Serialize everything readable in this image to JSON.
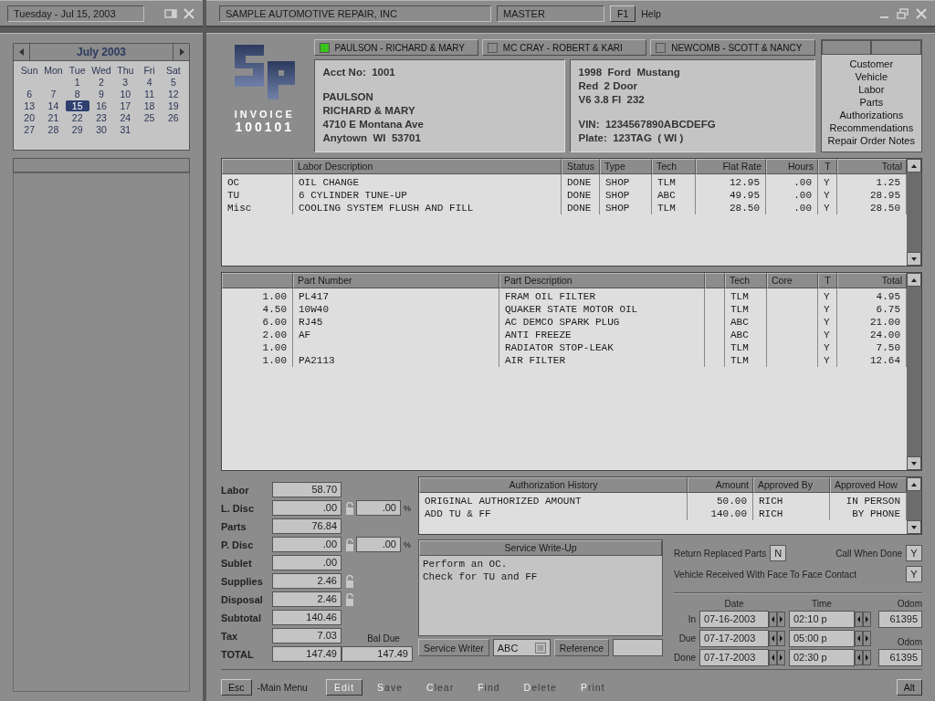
{
  "side": {
    "date_display": "Tuesday - Jul 15, 2003",
    "calendar": {
      "month_title": "July  2003",
      "weekdays": [
        "Sun",
        "Mon",
        "Tue",
        "Wed",
        "Thu",
        "Fri",
        "Sat"
      ],
      "weeks": [
        [
          {
            "day": "1",
            "selected": false
          },
          {
            "day": "2",
            "selected": false
          },
          {
            "day": "3",
            "selected": false
          },
          {
            "day": "4",
            "selected": false
          },
          {
            "day": "5",
            "selected": false
          }
        ],
        [
          {
            "day": "6",
            "selected": false
          },
          {
            "day": "7",
            "selected": false
          },
          {
            "day": "8",
            "selected": false
          },
          {
            "day": "9",
            "selected": false
          },
          {
            "day": "10",
            "selected": false
          },
          {
            "day": "11",
            "selected": false
          },
          {
            "day": "12",
            "selected": false
          }
        ],
        [
          {
            "day": "13",
            "selected": false
          },
          {
            "day": "14",
            "selected": false
          },
          {
            "day": "15",
            "selected": true
          },
          {
            "day": "16",
            "selected": false
          },
          {
            "day": "17",
            "selected": false
          },
          {
            "day": "18",
            "selected": false
          },
          {
            "day": "19",
            "selected": false
          }
        ],
        [
          {
            "day": "20",
            "selected": false
          },
          {
            "day": "21",
            "selected": false
          },
          {
            "day": "22",
            "selected": false
          },
          {
            "day": "23",
            "selected": false
          },
          {
            "day": "24",
            "selected": false
          },
          {
            "day": "25",
            "selected": false
          },
          {
            "day": "26",
            "selected": false
          }
        ],
        [
          {
            "day": "27",
            "selected": false
          },
          {
            "day": "28",
            "selected": false
          },
          {
            "day": "29",
            "selected": false
          },
          {
            "day": "30",
            "selected": false
          },
          {
            "day": "31",
            "selected": false
          }
        ]
      ]
    }
  },
  "top_bar": {
    "company": "SAMPLE AUTOMOTIVE REPAIR, INC",
    "mode": "MASTER",
    "help_key": "F1",
    "help_label": "Help"
  },
  "invoice": {
    "label": "INVOICE",
    "number": "100101"
  },
  "customer_tabs": [
    {
      "label": "PAULSON - RICHARD & MARY",
      "selected": true
    },
    {
      "label": "MC CRAY - ROBERT & KARI",
      "selected": false
    },
    {
      "label": "NEWCOMB - SCOTT & NANCY",
      "selected": false
    }
  ],
  "customer": {
    "account_label": "Acct No:",
    "account": "1001",
    "lines": [
      "PAULSON",
      "RICHARD & MARY",
      "4710 E Montana Ave",
      "Anytown  WI  53701"
    ]
  },
  "vehicle": {
    "lines": [
      "1998  Ford  Mustang",
      "Red  2 Door",
      "V6 3.8 FI  232"
    ],
    "vin_label": "VIN:",
    "vin": "1234567890ABCDEFG",
    "plate_label": "Plate:",
    "plate": "123TAG  ( WI )"
  },
  "nav_links": [
    "Customer",
    "Vehicle",
    "Labor",
    "Parts",
    "Authorizations",
    "Recommendations",
    "Repair Order Notes"
  ],
  "labor_table": {
    "columns": [
      "Labor  Description",
      "Status",
      "Type",
      "Tech",
      "Flat Rate",
      "Hours",
      "T",
      "Total"
    ],
    "rows": [
      {
        "code": "OC",
        "description": "OIL CHANGE",
        "status": "DONE",
        "type": "SHOP",
        "tech": "TLM",
        "flat_rate": "12.95",
        "hours": ".00",
        "t": "Y",
        "total": "1.25"
      },
      {
        "code": "TU",
        "description": "6 CYLINDER TUNE-UP",
        "status": "DONE",
        "type": "SHOP",
        "tech": "ABC",
        "flat_rate": "49.95",
        "hours": ".00",
        "t": "Y",
        "total": "28.95"
      },
      {
        "code": "Misc",
        "description": "COOLING SYSTEM FLUSH AND FILL",
        "status": "DONE",
        "type": "SHOP",
        "tech": "TLM",
        "flat_rate": "28.50",
        "hours": ".00",
        "t": "Y",
        "total": "28.50"
      }
    ]
  },
  "parts_table": {
    "columns": [
      "Part Number",
      "Part Description",
      "Tech",
      "Core",
      "T",
      "Total"
    ],
    "rows": [
      {
        "qty": "1.00",
        "part_number": "PL417",
        "description": "FRAM OIL FILTER",
        "tech": "TLM",
        "t": "Y",
        "total": "4.95"
      },
      {
        "qty": "4.50",
        "part_number": "10W40",
        "description": "QUAKER STATE MOTOR OIL",
        "tech": "TLM",
        "t": "Y",
        "total": "6.75"
      },
      {
        "qty": "6.00",
        "part_number": "RJ45",
        "description": "AC DEMCO SPARK PLUG",
        "tech": "ABC",
        "t": "Y",
        "total": "21.00"
      },
      {
        "qty": "2.00",
        "part_number": "AF",
        "description": "ANTI FREEZE",
        "tech": "ABC",
        "t": "Y",
        "total": "24.00"
      },
      {
        "qty": "1.00",
        "description": "RADIATOR STOP-LEAK",
        "tech": "TLM",
        "t": "Y",
        "total": "7.50"
      },
      {
        "qty": "1.00",
        "part_number": "PA2113",
        "description": "AIR FILTER",
        "tech": "TLM",
        "t": "Y",
        "total": "12.64"
      }
    ]
  },
  "totals": [
    {
      "label": "Labor",
      "value": "58.70",
      "kind": "plain"
    },
    {
      "label": "L. Disc",
      "value": ".00",
      "kind": "discount",
      "percent": ".00",
      "percent_sign": "%"
    },
    {
      "label": "Parts",
      "value": "76.84",
      "kind": "plain"
    },
    {
      "label": "P. Disc",
      "value": ".00",
      "kind": "discount",
      "percent": ".00",
      "percent_sign": "%"
    },
    {
      "label": "Sublet",
      "value": ".00",
      "kind": "plain"
    },
    {
      "label": "Supplies",
      "value": "2.46",
      "kind": "lock"
    },
    {
      "label": "Disposal",
      "value": "2.46",
      "kind": "lock"
    },
    {
      "label": "Subtotal",
      "value": "140.46",
      "kind": "plain"
    },
    {
      "label": "Tax",
      "value": "7.03",
      "kind": "plain"
    },
    {
      "label": "TOTAL",
      "value": "147.49",
      "kind": "plain"
    }
  ],
  "balance_due": {
    "label": "Bal Due",
    "value": "147.49"
  },
  "authorization_history": {
    "columns": [
      "Authorization  History",
      "Amount",
      "Approved By",
      "Approved How"
    ],
    "rows": [
      [
        "ORIGINAL AUTHORIZED AMOUNT",
        "50.00",
        "RICH",
        "IN PERSON"
      ],
      [
        "ADD TU & FF",
        "140.00",
        "RICH",
        "BY PHONE"
      ]
    ]
  },
  "service_writeup": {
    "title": "Service  Write-Up",
    "lines": [
      "Perform an OC.",
      "Check for TU and FF"
    ],
    "writer_label": "Service Writer",
    "writer": "ABC",
    "reference_label": "Reference"
  },
  "flags": [
    {
      "label": "Return Replaced Parts",
      "value": "N"
    },
    {
      "label": "Call When Done",
      "value": "Y"
    },
    {
      "label": "Vehicle Received With Face To Face Contact",
      "value": "Y"
    }
  ],
  "schedule": {
    "date_header": "Date",
    "time_header": "Time",
    "odom_header": "Odom",
    "rows": [
      {
        "label": "In",
        "date": "07-16-2003",
        "time": "02:10 p",
        "odom": "61395"
      },
      {
        "label": "Due",
        "date": "07-17-2003",
        "time": "05:00 p"
      },
      {
        "label": "Done",
        "date": "07-17-2003",
        "time": "02:30 p",
        "odom_label": "Odom",
        "odom": "61395"
      }
    ]
  },
  "footer": {
    "esc_key": "Esc",
    "esc_label": "-Main Menu",
    "actions": [
      {
        "label": "Edit",
        "kind": "button"
      },
      {
        "label": "Save",
        "kind": "text"
      },
      {
        "label": "Clear",
        "kind": "text"
      },
      {
        "label": "Find",
        "kind": "text"
      },
      {
        "label": "Delete",
        "kind": "text"
      },
      {
        "label": "Print",
        "kind": "text"
      }
    ],
    "alt": "Alt"
  }
}
